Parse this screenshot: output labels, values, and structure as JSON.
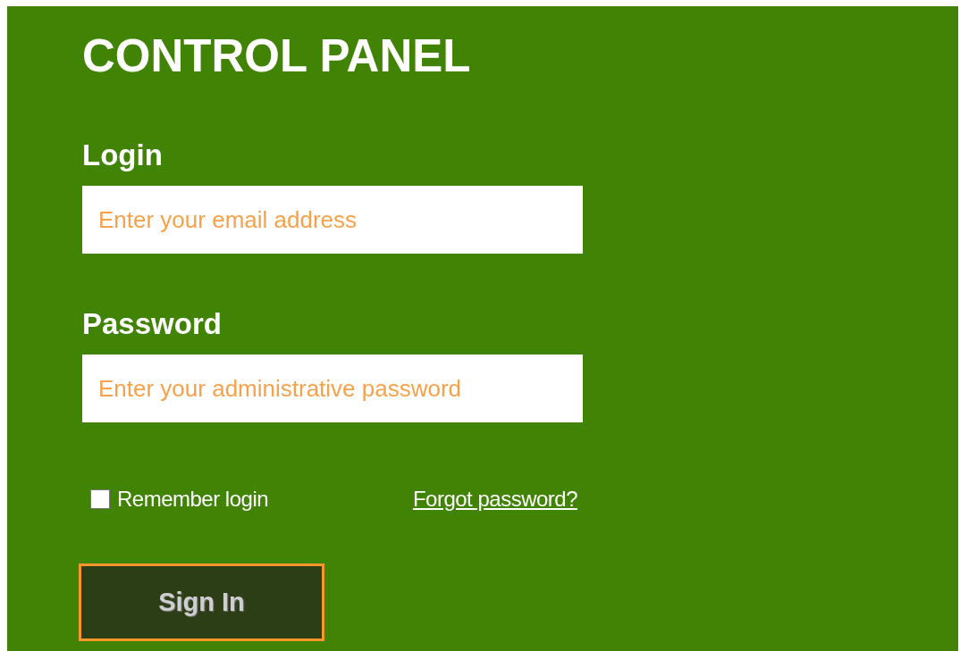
{
  "title": "CONTROL PANEL",
  "fields": [
    {
      "label": "Login",
      "placeholder": "Enter your email address"
    },
    {
      "label": "Password",
      "placeholder": "Enter your administrative password"
    }
  ],
  "remember": {
    "label": "Remember login",
    "checked": false
  },
  "forgot_link": "Forgot password?",
  "sign_in_button": "Sign In"
}
